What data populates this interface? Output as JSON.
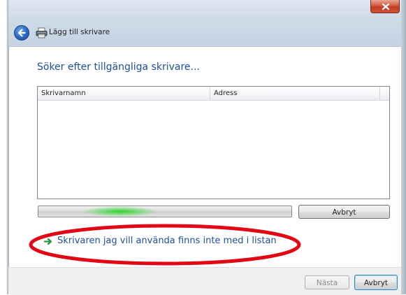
{
  "window": {
    "title": "Lägg till skrivare",
    "close_label": "x"
  },
  "main": {
    "heading": "Söker efter tillgängliga skrivare...",
    "columns": [
      "Skrivarnamn",
      "Adress"
    ],
    "progress_indeterminate": true,
    "cancel_search_label": "Avbryt",
    "missing_printer_link": "Skrivaren jag vill använda finns inte med i listan"
  },
  "footer": {
    "next_label": "Nästa",
    "cancel_label": "Avbryt"
  },
  "colors": {
    "heading": "#1e4f9c",
    "link": "#1e4f9c",
    "progress_glow": "#2ad22a",
    "highlight_ellipse": "#e30613"
  },
  "icons": {
    "back": "back-arrow-icon",
    "printer": "printer-icon",
    "link_arrow": "green-arrow-icon",
    "close": "close-icon"
  }
}
